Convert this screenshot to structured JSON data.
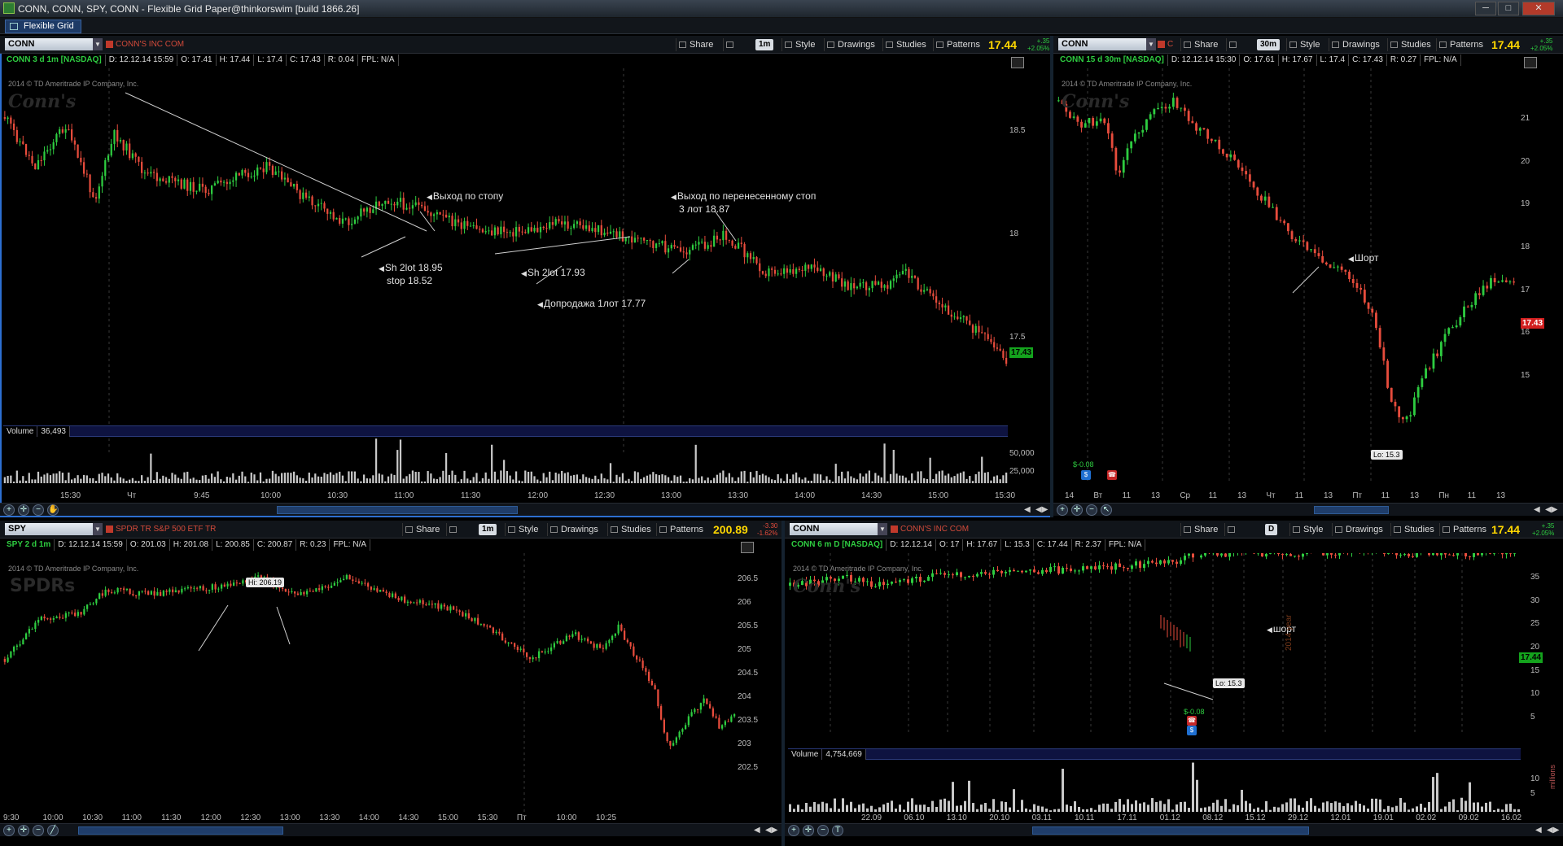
{
  "window": {
    "title": "CONN, CONN, SPY, CONN - Flexible Grid Paper@thinkorswim [build 1866.26]",
    "min": "─",
    "max": "□",
    "close": "✕",
    "tab": "Flexible Grid"
  },
  "colors": {
    "up": "#2ecc40",
    "down": "#e74c3c",
    "price_tag_green": "#14a31d",
    "price_tag_red": "#d21f1f",
    "accent": "#2d6fd1",
    "last": "#ffd700"
  },
  "toolbar_labels": {
    "share": "Share",
    "style": "Style",
    "drawings": "Drawings",
    "studies": "Studies",
    "patterns": "Patterns"
  },
  "panels": {
    "p1": {
      "symbol": "CONN",
      "company": "CONN'S INC COM",
      "timeframe": "1m",
      "last": "17.44",
      "netchg_top": "+.35",
      "netchg_bottom": "+2.05%",
      "info": {
        "sym": "CONN 3 d 1m [NASDAQ]",
        "d": "D: 12.12.14 15:59",
        "o": "O: 17.41",
        "h": "H: 17.44",
        "l": "L: 17.4",
        "c": "C: 17.43",
        "r": "R: 0.04",
        "fpl": "FPL: N/A"
      },
      "copyright": "2014 © TD Ameritrade IP Company, Inc.",
      "watermark": "Conn's",
      "y_ticks": [
        "18.5",
        "18",
        "17.5"
      ],
      "price_tag": "17.43",
      "volume_label": "Volume",
      "volume_value": "36,493",
      "vol_ticks": [
        "50,000",
        "25,000"
      ],
      "x_ticks": [
        "15:30",
        "Чт",
        "9:45",
        "10:00",
        "10:30",
        "11:00",
        "11:30",
        "12:00",
        "12:30",
        "13:00",
        "13:30",
        "14:00",
        "14:30",
        "15:00",
        "15:30"
      ],
      "annotations": {
        "a1": "Выход по стопу",
        "a2_line1": "Выход по перенесенному стоп",
        "a2_line2": "3 лот 18.87",
        "a3_line1": "Sh 2lot  18.95",
        "a3_line2": "stop 18.52",
        "a4": "Sh 2lot  17.93",
        "a5": "Допродажа 1лот 17.77"
      }
    },
    "p2": {
      "symbol": "CONN",
      "company": "C",
      "timeframe": "30m",
      "last": "17.44",
      "netchg_top": "+.35",
      "netchg_bottom": "+2.05%",
      "info": {
        "sym": "CONN 15 d 30m [NASDAQ]",
        "d": "D: 12.12.14 15:30",
        "o": "O: 17.61",
        "h": "H: 17.67",
        "l": "L: 17.4",
        "c": "C: 17.43",
        "r": "R: 0.27",
        "fpl": "FPL: N/A"
      },
      "copyright": "2014 © TD Ameritrade IP Company, Inc.",
      "watermark": "Conn's",
      "y_ticks": [
        "21",
        "20",
        "19",
        "18",
        "17",
        "16",
        "15"
      ],
      "price_tag": "17.43",
      "annotation": "Шорт",
      "lo_bubble": "Lo: 15.3",
      "div_label": "$-0.08",
      "x_ticks": [
        "14",
        "Вт",
        "11",
        "13",
        "Ср",
        "11",
        "13",
        "Чт",
        "11",
        "13",
        "Пт",
        "11",
        "13",
        "Пн",
        "11",
        "13"
      ]
    },
    "p3": {
      "symbol": "SPY",
      "company": "SPDR TR S&P 500 ETF TR",
      "timeframe": "1m",
      "last": "200.89",
      "netchg_top": "-3.30",
      "netchg_bottom": "-1.62%",
      "info": {
        "sym": "SPY 2 d 1m",
        "d": "D: 12.12.14 15:59",
        "o": "O: 201.03",
        "h": "H: 201.08",
        "l": "L: 200.85",
        "c": "C: 200.87",
        "r": "R: 0.23",
        "fpl": "FPL: N/A"
      },
      "copyright": "2014 © TD Ameritrade IP Company, Inc.",
      "watermark": "SPDRs",
      "y_ticks": [
        "206.5",
        "206",
        "205.5",
        "205",
        "204.5",
        "204",
        "203.5",
        "203",
        "202.5"
      ],
      "hi_bubble": "Hi: 206.19",
      "x_ticks": [
        "9:30",
        "10:00",
        "10:30",
        "11:00",
        "11:30",
        "12:00",
        "12:30",
        "13:00",
        "13:30",
        "14:00",
        "14:30",
        "15:00",
        "15:30",
        "Пт",
        "10:00",
        "10:25"
      ]
    },
    "p4": {
      "symbol": "CONN",
      "company": "CONN'S INC COM",
      "timeframe": "D",
      "last": "17.44",
      "netchg_top": "+.35",
      "netchg_bottom": "+2.05%",
      "info": {
        "sym": "CONN 6 m D [NASDAQ]",
        "d": "D: 12.12.14",
        "o": "O: 17",
        "h": "H: 17.67",
        "l": "L: 15.3",
        "c": "C: 17.44",
        "r": "R: 2.37",
        "fpl": "FPL: N/A"
      },
      "copyright": "2014 © TD Ameritrade IP Company, Inc.",
      "watermark": "Conn's",
      "y_ticks": [
        "35",
        "30",
        "25",
        "20",
        "15",
        "10",
        "5"
      ],
      "price_tag": "17.44",
      "annotation": "шорт",
      "lo_bubble": "Lo: 15.3",
      "div_label": "$-0.08",
      "year_label": "2014 year",
      "volume_label": "Volume",
      "volume_value": "4,754,669",
      "vol_ticks": [
        "10",
        "5"
      ],
      "vol_unit": "millions",
      "x_ticks": [
        "22.09",
        "06.10",
        "13.10",
        "20.10",
        "03.11",
        "10.11",
        "17.11",
        "01.12",
        "08.12",
        "15.12",
        "29.12",
        "12.01",
        "19.01",
        "02.02",
        "09.02",
        "16.02"
      ]
    }
  }
}
